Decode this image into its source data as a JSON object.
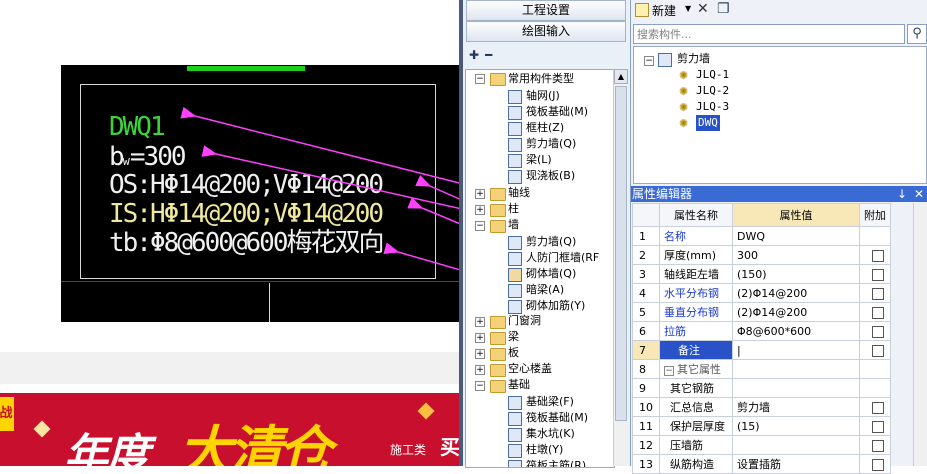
{
  "cad": {
    "lines": [
      "DWQ1",
      "b",
      "w",
      "=300",
      "OS:HΦ14@200;VΦ14@200",
      "IS:HΦ14@200;VΦ14@200",
      "tb:Φ8@600@600梅花双向"
    ],
    "colors": {
      "title": "#3cd43c",
      "white": "#f0f0f0",
      "yellow": "#f0e89c",
      "arrow": "#ff40ff"
    }
  },
  "banner": {
    "edge": "战",
    "word1": "年度",
    "word2": "大清仓",
    "small": "施工类",
    "buy": "买"
  },
  "nav": {
    "tab1": "工程设置",
    "tab2": "绘图输入",
    "expand": "➕",
    "collapse": "➖"
  },
  "tree": {
    "common": "常用构件类型",
    "common_items": [
      "轴网(J)",
      "筏板基础(M)",
      "框柱(Z)",
      "剪力墙(Q)",
      "梁(L)",
      "现浇板(B)"
    ],
    "axis": "轴线",
    "column": "柱",
    "wall": "墙",
    "wall_items": [
      "剪力墙(Q)",
      "人防门框墙(RF",
      "砌体墙(Q)",
      "暗梁(A)",
      "砌体加筋(Y)"
    ],
    "door": "门窗洞",
    "beam": "梁",
    "slab": "板",
    "hollow": "空心楼盖",
    "base": "基础",
    "base_items": [
      "基础梁(F)",
      "筏板基础(M)",
      "集水坑(K)",
      "柱墩(Y)",
      "筏板主筋(R)"
    ]
  },
  "toolbar": {
    "new": "新建",
    "delete": "✕",
    "copy": "❐"
  },
  "search": {
    "placeholder": "搜索构件..."
  },
  "components": {
    "root": "剪力墙",
    "items": [
      "JLQ-1",
      "JLQ-2",
      "JLQ-3",
      "DWQ"
    ],
    "selected": "DWQ"
  },
  "props": {
    "title": "属性编辑器",
    "pin": "↓",
    "close": "✕",
    "headers": [
      "属性名称",
      "属性值",
      "附加"
    ],
    "rows": [
      {
        "n": "1",
        "name": "名称",
        "value": "DWQ"
      },
      {
        "n": "2",
        "name": "厚度(mm)",
        "value": "300"
      },
      {
        "n": "3",
        "name": "轴线距左墙",
        "value": "(150)"
      },
      {
        "n": "4",
        "name": "水平分布钢",
        "value": "(2)Φ14@200"
      },
      {
        "n": "5",
        "name": "垂直分布钢",
        "value": "(2)Φ14@200"
      },
      {
        "n": "6",
        "name": "拉筋",
        "value": "Φ8@600*600"
      },
      {
        "n": "7",
        "name": "备注",
        "value": "|"
      },
      {
        "n": "8",
        "name": "其它属性",
        "value": ""
      },
      {
        "n": "9",
        "name": "其它钢筋",
        "value": ""
      },
      {
        "n": "10",
        "name": "汇总信息",
        "value": "剪力墙"
      },
      {
        "n": "11",
        "name": "保护层厚度",
        "value": "(15)"
      },
      {
        "n": "12",
        "name": "压墙筋",
        "value": ""
      },
      {
        "n": "13",
        "name": "纵筋构造",
        "value": "设置插筋"
      }
    ]
  }
}
